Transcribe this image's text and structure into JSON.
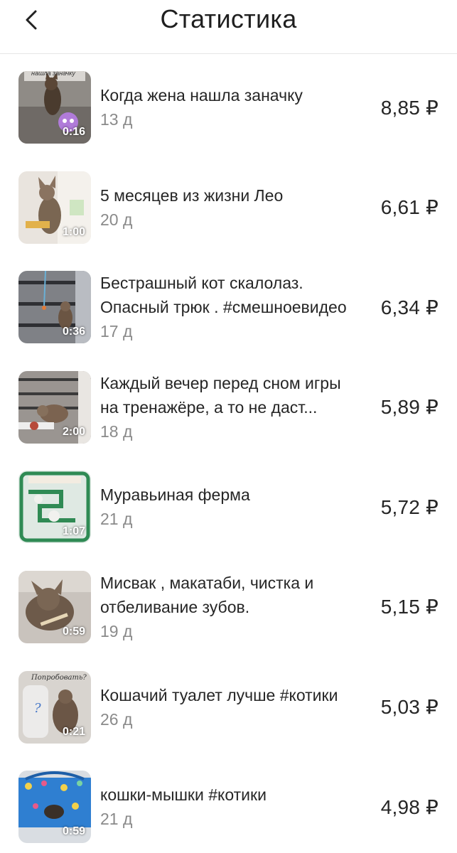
{
  "header": {
    "title": "Статистика"
  },
  "videos": [
    {
      "title_lines": [
        "Когда жена нашла заначку"
      ],
      "age": "13 д",
      "amount": "8,85 ₽",
      "duration": "0:16",
      "overlay_text": "нашла заначку"
    },
    {
      "title_lines": [
        "5 месяцев из жизни Лео"
      ],
      "age": "20 д",
      "amount": "6,61 ₽",
      "duration": "1:00"
    },
    {
      "title_lines": [
        "Бестрашный кот скалолаз.",
        "Опасный трюк . #смешноевидео"
      ],
      "age": "17 д",
      "amount": "6,34 ₽",
      "duration": "0:36"
    },
    {
      "title_lines": [
        "Каждый вечер перед сном игры",
        "на тренажёре, а то не даст..."
      ],
      "age": "18 д",
      "amount": "5,89 ₽",
      "duration": "2:00"
    },
    {
      "title_lines": [
        "Муравьиная ферма"
      ],
      "age": "21 д",
      "amount": "5,72 ₽",
      "duration": "1:07"
    },
    {
      "title_lines": [
        "Мисвак , макатаби, чистка и",
        "отбеливание зубов."
      ],
      "age": "19 д",
      "amount": "5,15 ₽",
      "duration": "0:59"
    },
    {
      "title_lines": [
        "Кошачий туалет лучше #котики"
      ],
      "age": "26 д",
      "amount": "5,03 ₽",
      "duration": "0:21",
      "overlay_text": "Попробовать?"
    },
    {
      "title_lines": [
        "кошки-мышки #котики"
      ],
      "age": "21 д",
      "amount": "4,98 ₽",
      "duration": "0:59"
    }
  ]
}
